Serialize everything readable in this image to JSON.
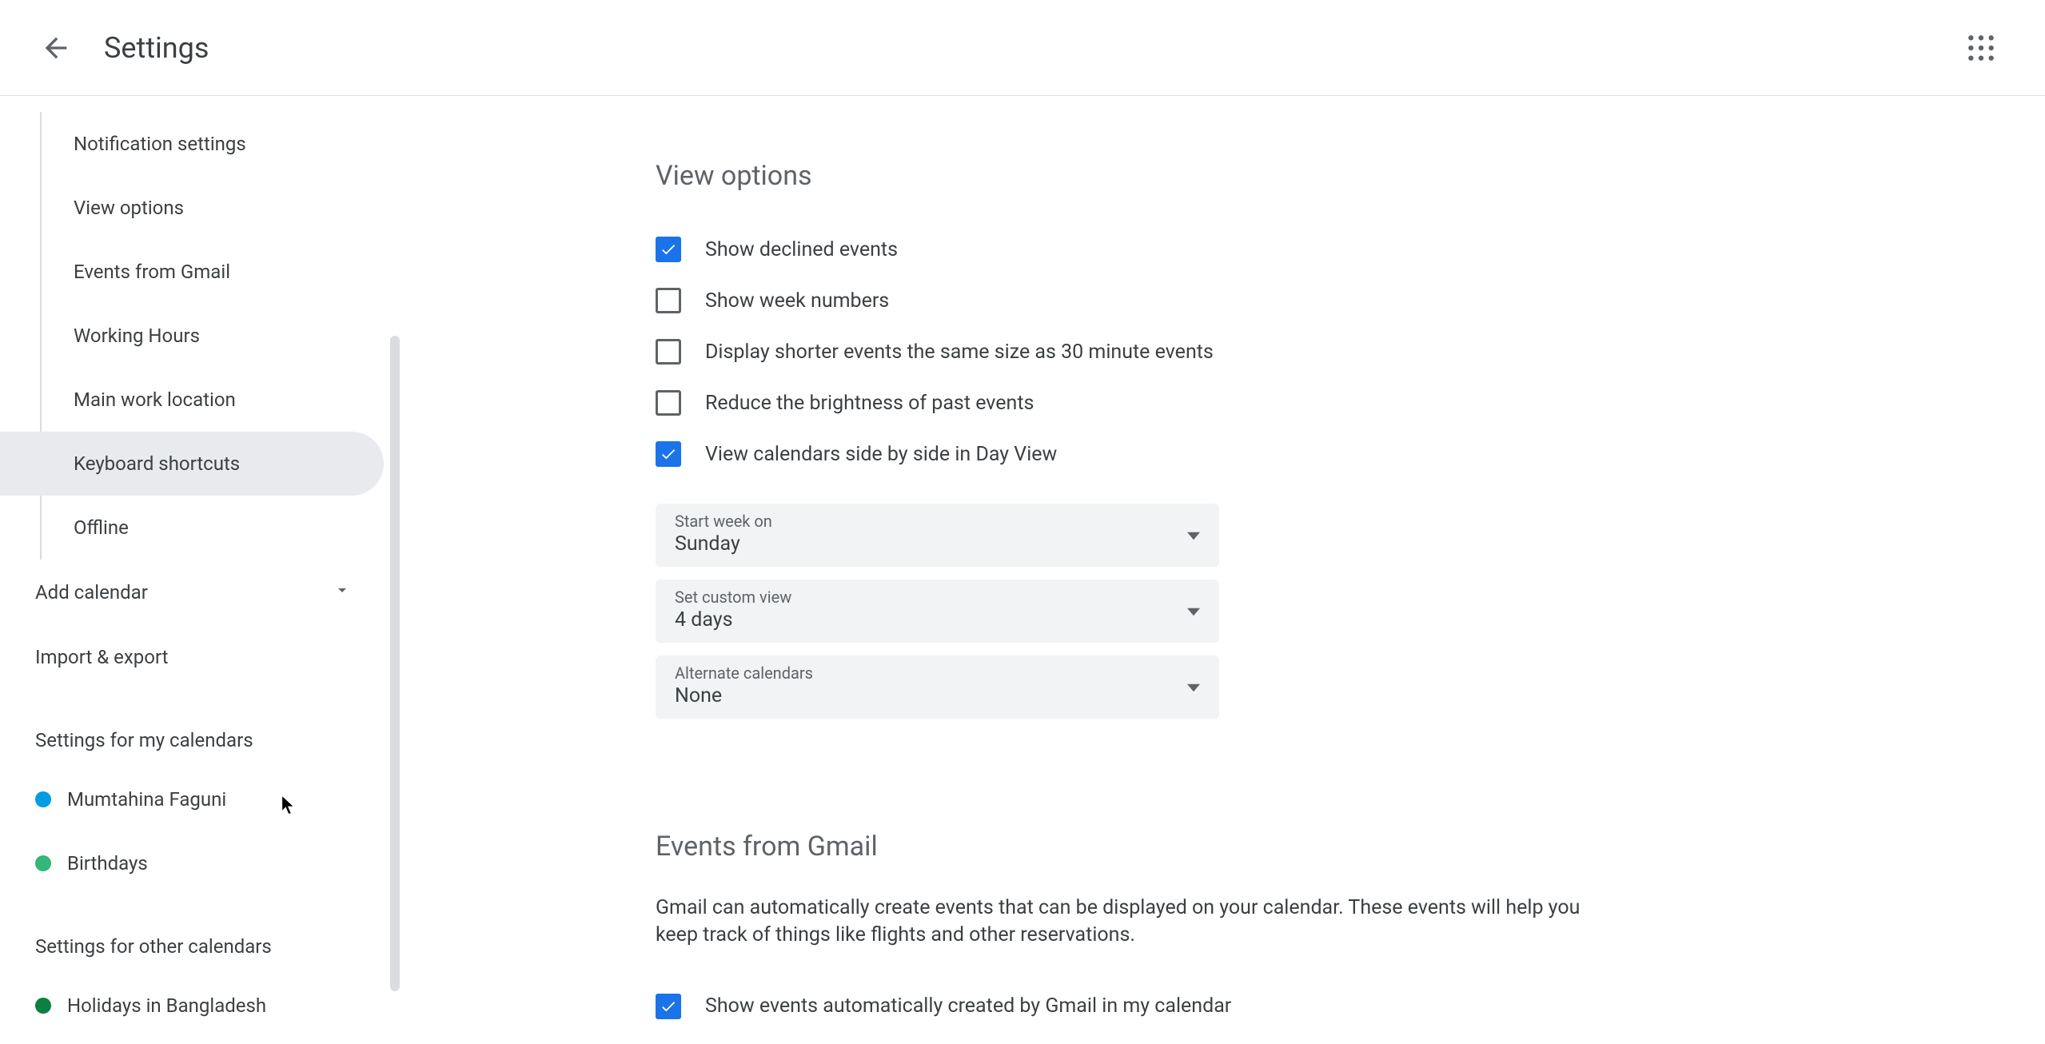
{
  "header": {
    "title": "Settings"
  },
  "sidebar": {
    "nav_items": [
      {
        "label": "Notification settings",
        "active": false
      },
      {
        "label": "View options",
        "active": false
      },
      {
        "label": "Events from Gmail",
        "active": false
      },
      {
        "label": "Working Hours",
        "active": false
      },
      {
        "label": "Main work location",
        "active": false
      },
      {
        "label": "Keyboard shortcuts",
        "active": true
      },
      {
        "label": "Offline",
        "active": false
      }
    ],
    "add_calendar": "Add calendar",
    "import_export": "Import & export",
    "section_my": "Settings for my calendars",
    "my_calendars": [
      {
        "label": "Mumtahina Faguni",
        "color": "#039be5"
      },
      {
        "label": "Birthdays",
        "color": "#33b679"
      }
    ],
    "section_other": "Settings for other calendars",
    "other_calendars": [
      {
        "label": "Holidays in Bangladesh",
        "color": "#0b8043"
      }
    ]
  },
  "main": {
    "view_options": {
      "title": "View options",
      "checks": [
        {
          "label": "Show declined events",
          "checked": true
        },
        {
          "label": "Show week numbers",
          "checked": false
        },
        {
          "label": "Display shorter events the same size as 30 minute events",
          "checked": false
        },
        {
          "label": "Reduce the brightness of past events",
          "checked": false
        },
        {
          "label": "View calendars side by side in Day View",
          "checked": true
        }
      ],
      "selects": [
        {
          "label": "Start week on",
          "value": "Sunday"
        },
        {
          "label": "Set custom view",
          "value": "4 days"
        },
        {
          "label": "Alternate calendars",
          "value": "None"
        }
      ]
    },
    "events_gmail": {
      "title": "Events from Gmail",
      "desc": "Gmail can automatically create events that can be displayed on your calendar. These events will help you keep track of things like flights and other reservations.",
      "check": {
        "label": "Show events automatically created by Gmail in my calendar",
        "checked": true
      }
    }
  }
}
